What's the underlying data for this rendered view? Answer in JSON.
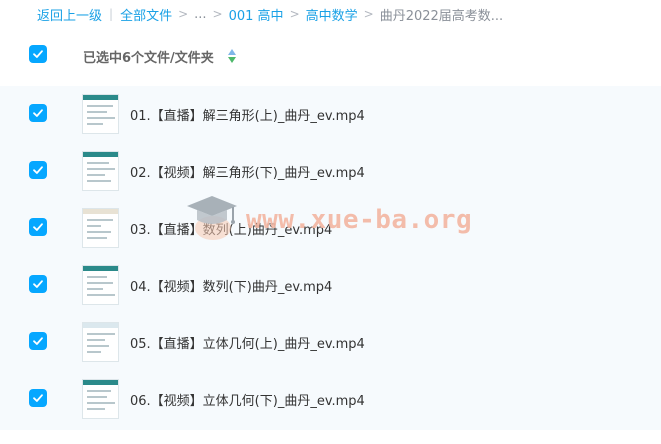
{
  "breadcrumb": {
    "back": "返回上一级",
    "all_files": "全部文件",
    "ellipsis": "...",
    "folder1": "001 高中",
    "folder2": "高中数学",
    "current": "曲丹2022届高考数..."
  },
  "header": {
    "selection_text": "已选中6个文件/文件夹"
  },
  "files": [
    {
      "name": "01.【直播】解三角形(上)_曲丹_ev.mp4",
      "checked": true
    },
    {
      "name": "02.【视频】解三角形(下)_曲丹_ev.mp4",
      "checked": true
    },
    {
      "name": "03.【直播】数列(上)曲丹_ev.mp4",
      "checked": true
    },
    {
      "name": "04.【视频】数列(下)曲丹_ev.mp4",
      "checked": true
    },
    {
      "name": "05.【直播】立体几何(上)_曲丹_ev.mp4",
      "checked": true
    },
    {
      "name": "06.【视频】立体几何(下)_曲丹_ev.mp4",
      "checked": true
    }
  ],
  "watermark": {
    "text": "www.xue-ba.org",
    "icon": "graduation-cap-icon"
  },
  "colors": {
    "accent": "#06a7ff",
    "link": "#1aa1e6",
    "list_bg": "#f6fafd",
    "watermark": "#f3b6a2"
  }
}
